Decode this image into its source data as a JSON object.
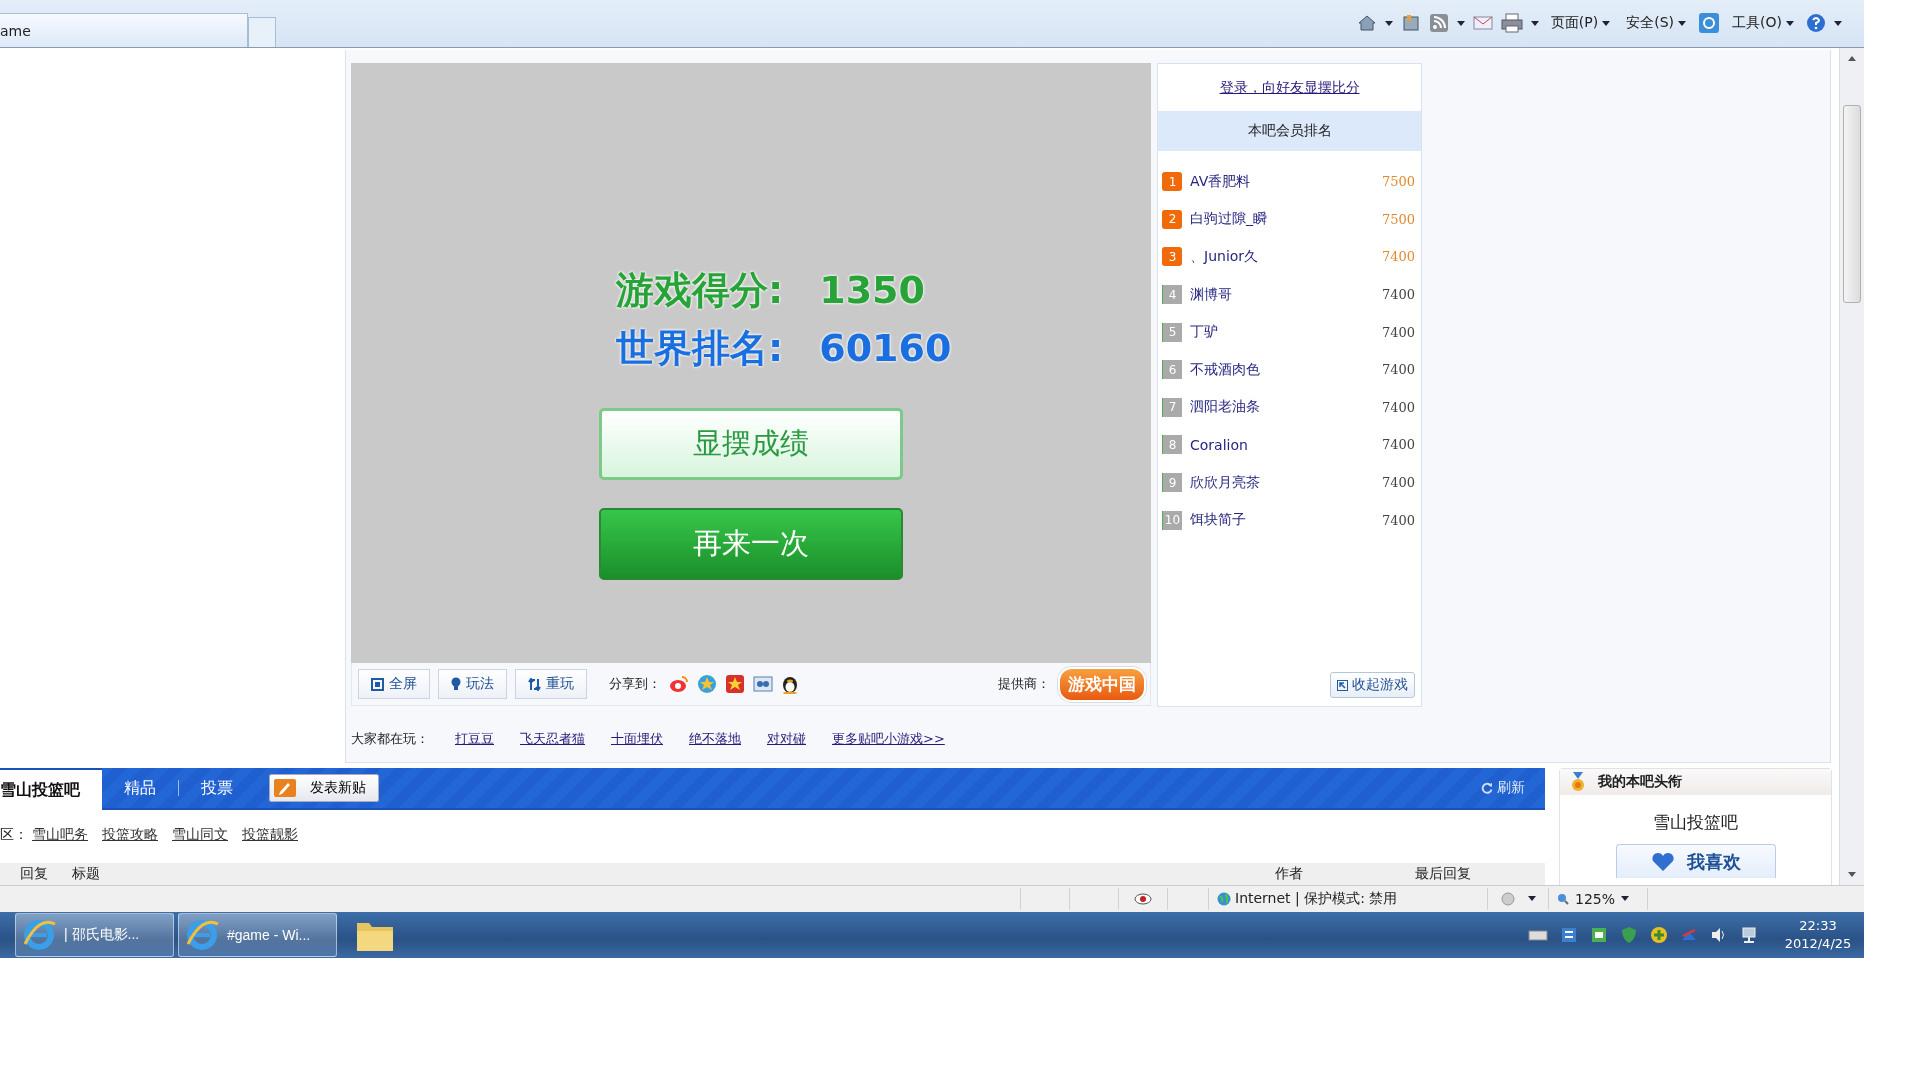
{
  "browser": {
    "tab_title": "ame",
    "menus": [
      "页面(P)",
      "安全(S)",
      "工具(O)"
    ]
  },
  "game": {
    "score_label": "游戏得分:",
    "score": "1350",
    "rank_label": "世界排名:",
    "rank": "60160",
    "share_button": "显摆成绩",
    "retry_button": "再来一次",
    "controls": [
      {
        "kind": "fullscreen",
        "label": "全屏"
      },
      {
        "kind": "help",
        "label": "玩法"
      },
      {
        "kind": "replay",
        "label": "重玩"
      }
    ],
    "share_label": "分享到：",
    "provider_label": "提供商：",
    "provider_logo": "游戏中国"
  },
  "leaderboard": {
    "login_link": "登录，向好友显摆比分",
    "title": "本吧会员排名",
    "collapse_button": "收起游戏",
    "rows": [
      {
        "rank": "1",
        "name": "AV香肥料",
        "score": "7500",
        "top": true
      },
      {
        "rank": "2",
        "name": "白驹过隙_瞬",
        "score": "7500",
        "top": true
      },
      {
        "rank": "3",
        "name": "、Junior久",
        "score": "7400",
        "top": true
      },
      {
        "rank": "4",
        "name": "渊博哥",
        "score": "7400",
        "top": false
      },
      {
        "rank": "5",
        "name": "丁驴",
        "score": "7400",
        "top": false
      },
      {
        "rank": "6",
        "name": "不戒酒肉色",
        "score": "7400",
        "top": false
      },
      {
        "rank": "7",
        "name": "泗阳老油条",
        "score": "7400",
        "top": false
      },
      {
        "rank": "8",
        "name": "Coralion",
        "score": "7400",
        "top": false
      },
      {
        "rank": "9",
        "name": "欣欣月亮茶",
        "score": "7400",
        "top": false
      },
      {
        "rank": "10",
        "name": "饵块简子",
        "score": "7400",
        "top": false
      }
    ]
  },
  "playing": {
    "label": "大家都在玩：",
    "games": [
      "打豆豆",
      "飞天忍者猫",
      "十面埋伏",
      "绝不落地",
      "对对碰",
      "更多贴吧小游戏>>"
    ]
  },
  "forum": {
    "tabs": [
      {
        "label": "雪山投篮吧",
        "selected": true
      },
      {
        "label": "精品",
        "selected": false
      },
      {
        "label": "投票",
        "selected": false
      }
    ],
    "post_button": "发表新贴",
    "refresh": "刷新",
    "zone_label": "区：",
    "zones": [
      "雪山吧务",
      "投篮攻略",
      "雪山同文",
      "投篮靓影"
    ],
    "columns": [
      "回复",
      "标题",
      "作者",
      "最后回复"
    ]
  },
  "title_card": {
    "title": "我的本吧头衔",
    "forum_name": "雪山投篮吧",
    "like_button": "我喜欢"
  },
  "status_bar": {
    "zone": "Internet | 保护模式: 禁用",
    "zoom": "125%"
  },
  "taskbar": {
    "windows": [
      "| 邵氏电影...",
      "#game - Wi..."
    ],
    "time": "22:33",
    "date": "2012/4/25"
  }
}
